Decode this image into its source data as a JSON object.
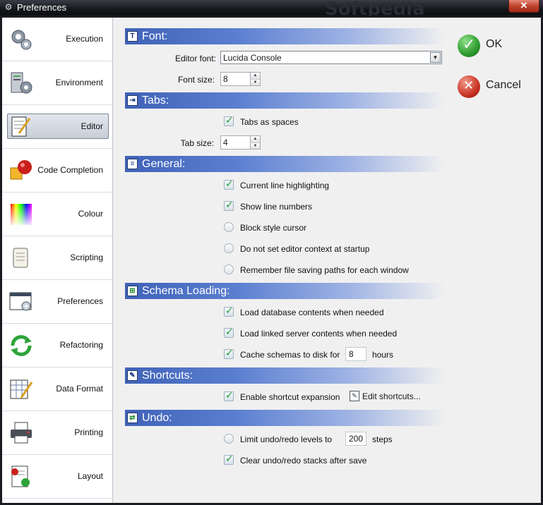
{
  "window": {
    "title": "Preferences",
    "close_glyph": "✕"
  },
  "sidebar": {
    "items": [
      {
        "label": "Execution",
        "icon": "gears-icon"
      },
      {
        "label": "Environment",
        "icon": "server-gear-icon"
      },
      {
        "label": "Editor",
        "icon": "notepad-pencil-icon",
        "selected": true
      },
      {
        "label": "Code Completion",
        "icon": "cube-ball-icon"
      },
      {
        "label": "Colour",
        "icon": "color-spectrum-icon"
      },
      {
        "label": "Scripting",
        "icon": "scroll-icon"
      },
      {
        "label": "Preferences",
        "icon": "window-settings-icon"
      },
      {
        "label": "Refactoring",
        "icon": "refresh-arrows-icon"
      },
      {
        "label": "Data Format",
        "icon": "grid-pencil-icon"
      },
      {
        "label": "Printing",
        "icon": "printer-icon"
      },
      {
        "label": "Layout",
        "icon": "layout-doc-icon"
      }
    ]
  },
  "sections": {
    "font": {
      "title": "Font:",
      "editor_font_label": "Editor font:",
      "editor_font_value": "Lucida Console",
      "font_size_label": "Font size:",
      "font_size_value": "8"
    },
    "tabs": {
      "title": "Tabs:",
      "tabs_as_spaces": "Tabs as spaces",
      "tab_size_label": "Tab size:",
      "tab_size_value": "4"
    },
    "general": {
      "title": "General:",
      "options": [
        {
          "label": "Current line highlighting",
          "checked": true,
          "kind": "check"
        },
        {
          "label": "Show line numbers",
          "checked": true,
          "kind": "check"
        },
        {
          "label": "Block style cursor",
          "checked": false,
          "kind": "radio"
        },
        {
          "label": "Do not set editor context at startup",
          "checked": false,
          "kind": "radio"
        },
        {
          "label": "Remember file saving paths for each window",
          "checked": false,
          "kind": "radio"
        }
      ]
    },
    "schema": {
      "title": "Schema Loading:",
      "load_db": "Load database contents when needed",
      "load_linked": "Load linked server contents when needed",
      "cache_label": "Cache schemas to disk for",
      "cache_value": "8",
      "cache_unit": "hours"
    },
    "shortcuts": {
      "title": "Shortcuts:",
      "enable": "Enable shortcut expansion",
      "edit_button": "Edit shortcuts..."
    },
    "undo": {
      "title": "Undo:",
      "limit_label": "Limit undo/redo levels to",
      "limit_value": "200",
      "limit_unit": "steps",
      "clear_label": "Clear undo/redo stacks after save"
    }
  },
  "actions": {
    "ok": "OK",
    "cancel": "Cancel"
  },
  "watermark": {
    "brand": "Softpedia"
  },
  "colors": {
    "section_blue": "#3f62b8",
    "selected_bg": "#c7ced8"
  }
}
